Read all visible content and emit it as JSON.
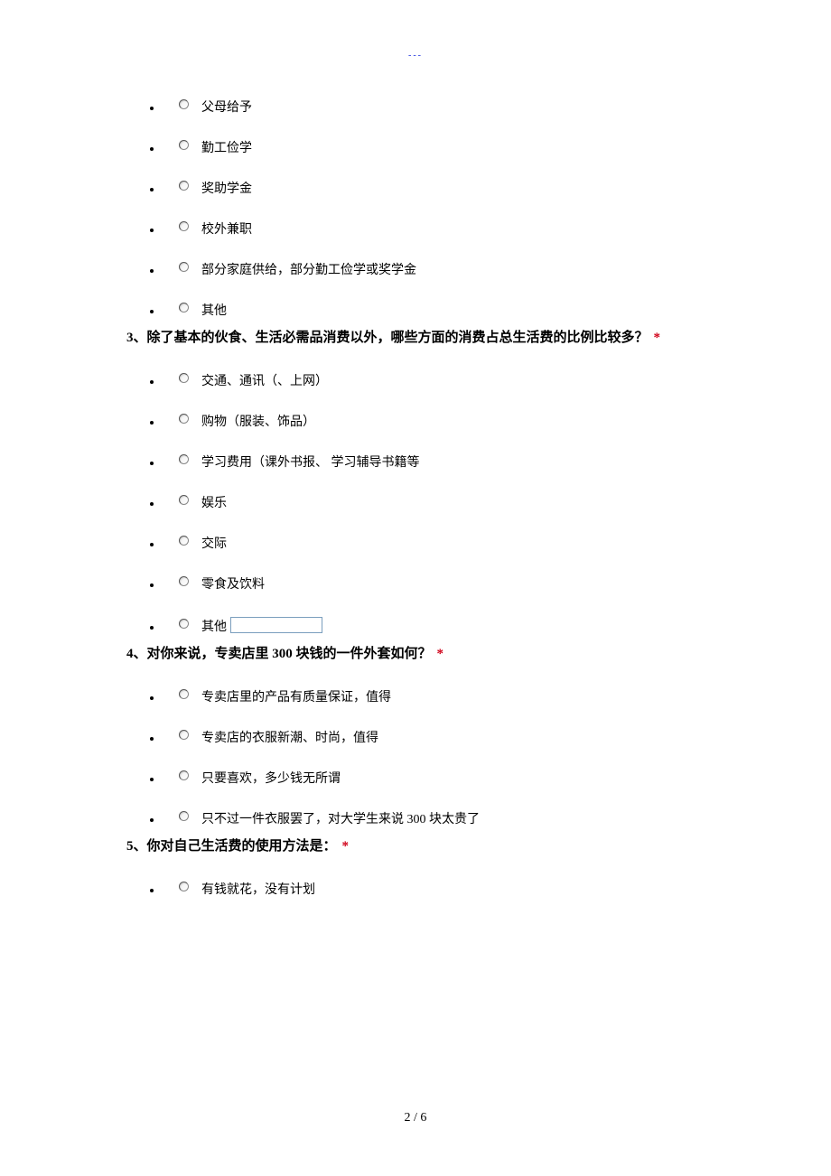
{
  "header_marker": "---",
  "q2_options": [
    "父母给予",
    "勤工俭学",
    "奖助学金",
    "校外兼职",
    "部分家庭供给，部分勤工俭学或奖学金",
    "其他"
  ],
  "q3": {
    "num": "3",
    "text": "、除了基本的伙食、生活必需品消费以外，哪些方面的消费占总生活费的比例比较多？",
    "asterisk": "*",
    "options": [
      "交通、通讯（、上网）",
      "购物（服装、饰品）",
      "学习费用（课外书报、 学习辅导书籍等",
      "娱乐",
      "交际",
      "零食及饮料"
    ],
    "other_label": "其他",
    "other_input_value": ""
  },
  "q4": {
    "num": "4",
    "text_a": "、对你来说，专卖店里 ",
    "price": "300",
    "text_b": " 块钱的一件外套如何？",
    "asterisk": "*",
    "options": [
      "专卖店里的产品有质量保证，值得",
      "专卖店的衣服新潮、时尚，值得",
      "只要喜欢，多少钱无所谓"
    ],
    "opt_last_a": "只不过一件衣服罢了，对大学生来说 ",
    "opt_last_price": "300",
    "opt_last_b": " 块太贵了"
  },
  "q5": {
    "num": "5",
    "text": "、你对自己生活费的使用方法是：",
    "asterisk": "*",
    "options": [
      "有钱就花，没有计划"
    ]
  },
  "footer": "2  /  6"
}
